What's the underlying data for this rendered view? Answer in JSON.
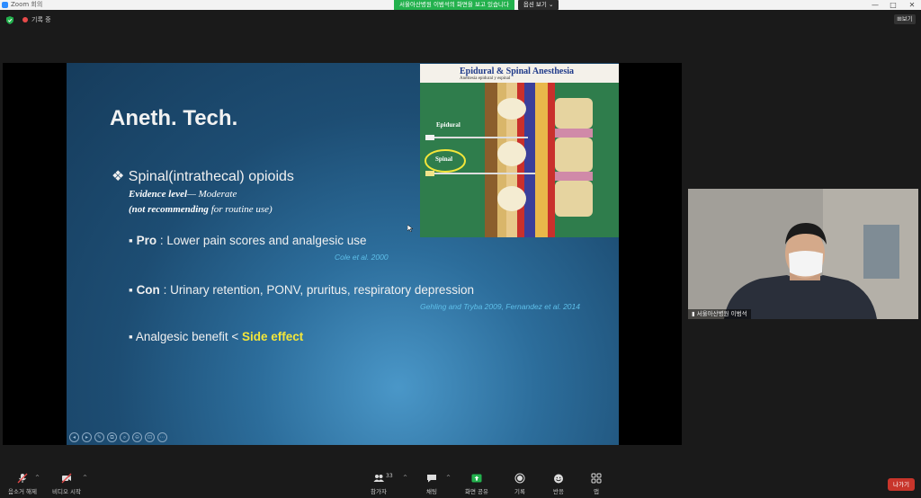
{
  "window": {
    "title": "Zoom 회의",
    "controls": [
      "—",
      "□",
      "✕"
    ]
  },
  "share_banner": {
    "text": "서울아산병원 이범석의 화면을 보고 있습니다",
    "options_label": "옵션 보기"
  },
  "topbar": {
    "recording_label": "기록 중",
    "view_button": "보기"
  },
  "slide": {
    "title": "Aneth. Tech.",
    "bullet_symbol": "❖",
    "bullet_main": "Spinal(intrathecal) opioids",
    "evidence_label": "Evidence level",
    "evidence_value": "— Moderate",
    "recommend_open": "(",
    "recommend_bold": "not recommending",
    "recommend_rest": " for routine use)",
    "items": [
      {
        "key": "Pro",
        "text": " : Lower pain scores and analgesic use",
        "citation": "Cole et al. 2000"
      },
      {
        "key": "Con",
        "text": " : Urinary retention, PONV, pruritus, respiratory depression",
        "citation": "Gehling and Tryba 2009, Fernandez et al. 2014"
      },
      {
        "key": "",
        "text": "Analgesic benefit < ",
        "highlight": "Side effect"
      }
    ],
    "sub_bullet": "▪",
    "figure": {
      "title": "Epidural & Spinal Anesthesia",
      "subtitle": "Anestesia epidural y espinal",
      "epidural_label": "Epidural",
      "spinal_label": "Spinal"
    },
    "controls": [
      "◂",
      "▸",
      "✎",
      "⧉",
      "⌕",
      "⊖",
      "⊡",
      "⋯"
    ]
  },
  "participant": {
    "name": "서울아산병원 이범석"
  },
  "toolbar": {
    "items": [
      {
        "label": "음소거 해제",
        "icon": "mic-muted-icon"
      },
      {
        "label": "비디오 시작",
        "icon": "video-off-icon"
      },
      {
        "label": "참가자",
        "icon": "participants-icon",
        "count": "33"
      },
      {
        "label": "채팅",
        "icon": "chat-icon"
      },
      {
        "label": "화면 공유",
        "icon": "share-screen-icon"
      },
      {
        "label": "기록",
        "icon": "record-icon"
      },
      {
        "label": "반응",
        "icon": "reaction-icon"
      },
      {
        "label": "앱",
        "icon": "apps-icon"
      }
    ],
    "leave_label": "나가기"
  },
  "colors": {
    "slide_bg": "#1d4d73",
    "citation": "#5fc0ea",
    "highlight": "#f3e63a",
    "share_green": "#23b14d",
    "leave_red": "#c8352b"
  }
}
